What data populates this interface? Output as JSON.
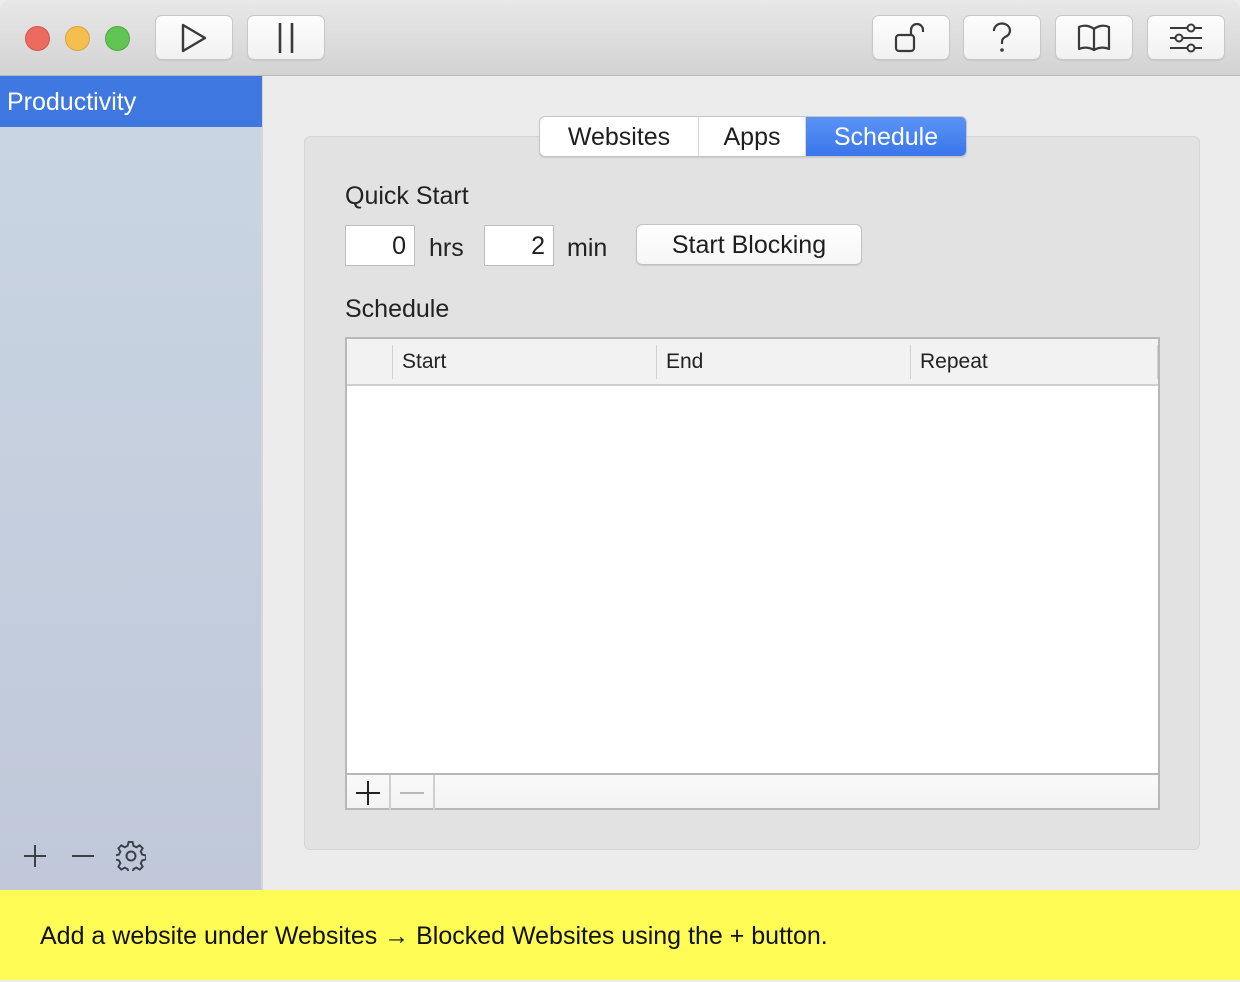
{
  "toolbar": {
    "buttons": [
      {
        "name": "play-icon",
        "label": "Start"
      },
      {
        "name": "pause-icon",
        "label": "Pause"
      },
      {
        "name": "unlock-icon",
        "label": "Unlock"
      },
      {
        "name": "help-icon",
        "label": "Help"
      },
      {
        "name": "book-icon",
        "label": "Guide"
      },
      {
        "name": "sliders-icon",
        "label": "Settings"
      }
    ]
  },
  "sidebar": {
    "items": [
      {
        "label": "Productivity",
        "selected": true
      }
    ],
    "footer": {
      "add": "+",
      "remove": "−",
      "settings": "gear-icon"
    }
  },
  "tabs": [
    {
      "label": "Websites",
      "active": false
    },
    {
      "label": "Apps",
      "active": false
    },
    {
      "label": "Schedule",
      "active": true
    }
  ],
  "quick_start": {
    "heading": "Quick Start",
    "hours_value": "0",
    "hours_unit": "hrs",
    "minutes_value": "2",
    "minutes_unit": "min",
    "start_button": "Start Blocking"
  },
  "schedule": {
    "heading": "Schedule",
    "columns": [
      "Start",
      "End",
      "Repeat"
    ],
    "rows": [],
    "add_label": "+",
    "remove_label": "−"
  },
  "hint": {
    "text": "Add a website under Websites → Blocked Websites using the + button."
  },
  "colors": {
    "accent": "#3f78e0",
    "hint_background": "#fffc55"
  }
}
